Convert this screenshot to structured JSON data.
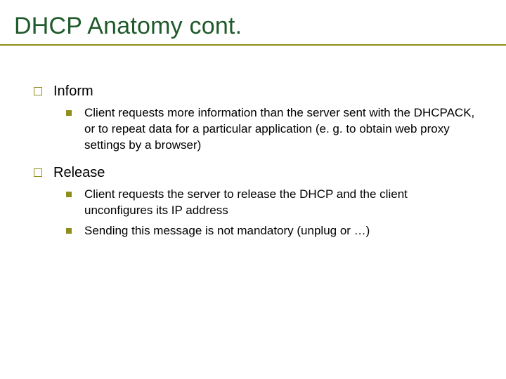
{
  "title": "DHCP Anatomy cont.",
  "sections": [
    {
      "label": "Inform",
      "items": [
        "Client requests more information than the server sent with the DHCPACK, or to repeat data for a particular application (e. g. to obtain web proxy settings by a browser)"
      ]
    },
    {
      "label": "Release",
      "items": [
        "Client requests the server to release the DHCP and the client unconfigures its IP address",
        "Sending this message is not mandatory (unplug or …)"
      ]
    }
  ]
}
